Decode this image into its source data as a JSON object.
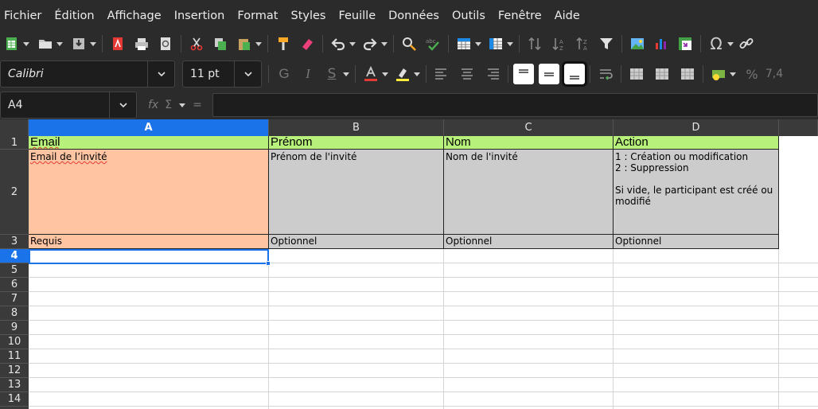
{
  "menu": [
    "Fichier",
    "Édition",
    "Affichage",
    "Insertion",
    "Format",
    "Styles",
    "Feuille",
    "Données",
    "Outils",
    "Fenêtre",
    "Aide"
  ],
  "toolbar": {
    "font_name": "Calibri",
    "font_size": "11 pt",
    "icons_row1": [
      "new-icon",
      "open-icon",
      "save-icon",
      "export-pdf-icon",
      "print-icon",
      "print-preview-icon",
      "cut-icon",
      "copy-icon",
      "paste-icon",
      "clone-format-icon",
      "clear-format-icon",
      "undo-icon",
      "redo-icon",
      "find-replace-icon",
      "spellcheck-icon",
      "row-icon",
      "column-icon",
      "sort-icon",
      "sort-ascending-icon",
      "sort-descending-icon",
      "autofilter-icon",
      "image-icon",
      "chart-icon",
      "pivot-table-icon",
      "special-character-icon",
      "hyperlink-icon"
    ],
    "colors": {
      "font_color": "#e53935",
      "highlight_color": "#ffeb3b"
    }
  },
  "formula_bar": {
    "cell_ref": "A4",
    "fx": "fx",
    "sigma": "Σ",
    "equals": "="
  },
  "sheet": {
    "columns": [
      "A",
      "B",
      "C",
      "D"
    ],
    "selected_column": "A",
    "rows": [
      "1",
      "2",
      "3",
      "4",
      "5",
      "6",
      "7",
      "8",
      "9",
      "10",
      "11",
      "12",
      "13",
      "14"
    ],
    "selected_row": "4",
    "header_row": [
      "Email",
      "Prénom",
      "Nom",
      "Action"
    ],
    "description_row": [
      "Email de l’invité",
      "Prénom de l'invité",
      "Nom de l'invité",
      "1 : Création ou modification\n2 : Suppression\n\nSi vide, le participant est créé ou modifié"
    ],
    "requirement_row": [
      "Requis",
      "Optionnel",
      "Optionnel",
      "Optionnel"
    ],
    "colors": {
      "header_fill": "#b7f07a",
      "required_fill": "#ffc5a3",
      "optional_fill": "#cccccc"
    }
  }
}
